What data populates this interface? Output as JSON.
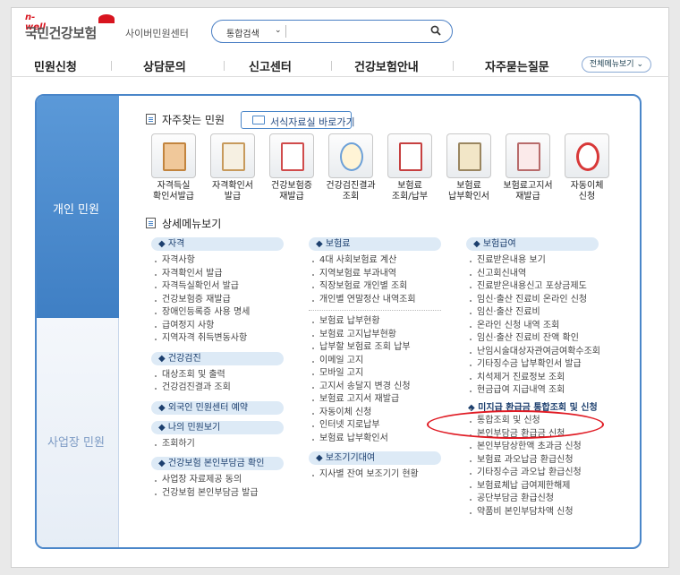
{
  "header": {
    "logo_small": "n-well",
    "logo_brand": "국민건강보험",
    "logo_sub": "사이버민원센터",
    "search_select": "통합검색",
    "search_placeholder": ""
  },
  "gnb": {
    "items": [
      "민원신청",
      "상담문의",
      "신고센터",
      "건강보험안내",
      "자주묻는질문"
    ],
    "all_menu": "전체메뉴보기"
  },
  "sidebar": {
    "personal": "개인 민원",
    "business": "사업장 민원"
  },
  "favorites": {
    "title": "자주찾는 민원",
    "forms_button": "서식자료실 바로가기",
    "items": [
      {
        "line1": "자격득실",
        "line2": "확인서발급",
        "icon": "clipboard-icon"
      },
      {
        "line1": "자격확인서",
        "line2": "발급",
        "icon": "document-icon"
      },
      {
        "line1": "건강보험증",
        "line2": "재발급",
        "icon": "card-icon"
      },
      {
        "line1": "건강검진결과",
        "line2": "조회",
        "icon": "chart-icon"
      },
      {
        "line1": "보험료",
        "line2": "조회/납부",
        "icon": "won-icon"
      },
      {
        "line1": "보험료",
        "line2": "납부확인서",
        "icon": "receipt-icon"
      },
      {
        "line1": "보험료고지서",
        "line2": "재발급",
        "icon": "bill-icon"
      },
      {
        "line1": "자동이체",
        "line2": "신청",
        "icon": "refresh-icon"
      }
    ]
  },
  "detail": {
    "title": "상세메뉴보기",
    "col1": {
      "cat1": "◆ 자격",
      "cat1_items": [
        "자격사항",
        "자격확인서 발급",
        "자격득실확인서 발급",
        "건강보험증 재발급",
        "장애인등록증 사용 명세",
        "급여정지 사항",
        "지역자격 취득변동사항"
      ],
      "cat2": "◆ 건강검진",
      "cat2_items": [
        "대상조회 및 출력",
        "건강검진결과 조회"
      ],
      "cat3": "◆ 외국인 민원센터 예약",
      "cat4": "◆ 나의 민원보기",
      "cat4_items": [
        "조회하기"
      ],
      "cat5": "◆ 건강보험 본인부담금 확인",
      "cat5_items": [
        "사업장 자료제공 동의",
        "건강보험 본인부담금 발급"
      ]
    },
    "col2": {
      "cat1": "◆ 보험료",
      "cat1_items_a": [
        "4대 사회보험료 계산",
        "지역보험료 부과내역",
        "직장보험료 개인별 조회",
        "개인별 연말정산 내역조회"
      ],
      "cat1_items_b": [
        "보험료 납부현황",
        "보험료 고지납부현황",
        "납부할 보험료 조회 납부",
        "이메일 고지",
        "모바일 고지",
        "고지서 송달지 변경 신청",
        "보험료 고지서 재발급",
        "자동이체 신청",
        "인터넷 지로납부",
        "보험료 납부확인서"
      ],
      "cat2": "◆ 보조기기대여",
      "cat2_items": [
        "지사별 잔여 보조기기 현황"
      ]
    },
    "col3": {
      "cat1": "◆ 보험급여",
      "items_a": [
        "진료받은내용 보기",
        "신고회신내역",
        "진료받은내용신고 포상금제도",
        "임신·출산 진료비 온라인 신청",
        "임신·출산 진료비",
        "온라인 신청 내역 조회",
        "임신·출산 진료비 잔액 확인",
        "난임시술대상자관여금여확수조회",
        "기타징수금 납부확인서 발급",
        "치석제거 진료정보 조회",
        "현금급여 지급내역 조회"
      ],
      "highlight": "◆ 미지급 환급금 통합조회 및 신청",
      "items_b": [
        "통합조회 및 신청",
        "본인부담금 환급금 신청",
        "본인부담상한액 초과금 신청",
        "보험료 과오납금 환급신청",
        "기타징수금 과오납 환급신청",
        "보험료체납 급여제한해제",
        "공단부담금 환급신청",
        "약품비 본인부담차액 신청"
      ]
    }
  }
}
